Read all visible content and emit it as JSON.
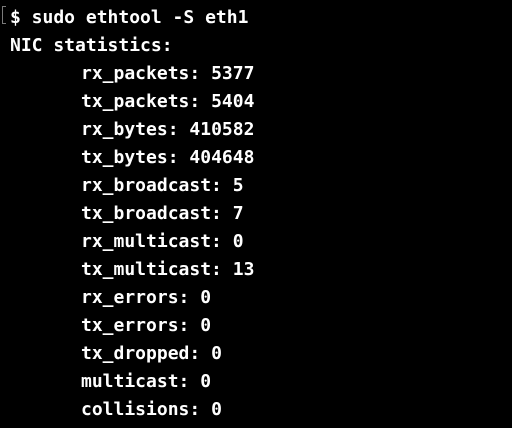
{
  "terminal": {
    "command": "$ sudo ethtool -S eth1",
    "header": "NIC statistics:",
    "stats": [
      {
        "name": "rx_packets",
        "value": "5377"
      },
      {
        "name": "tx_packets",
        "value": "5404"
      },
      {
        "name": "rx_bytes",
        "value": "410582"
      },
      {
        "name": "tx_bytes",
        "value": "404648"
      },
      {
        "name": "rx_broadcast",
        "value": "5"
      },
      {
        "name": "tx_broadcast",
        "value": "7"
      },
      {
        "name": "rx_multicast",
        "value": "0"
      },
      {
        "name": "tx_multicast",
        "value": "13"
      },
      {
        "name": "rx_errors",
        "value": "0"
      },
      {
        "name": "tx_errors",
        "value": "0"
      },
      {
        "name": "tx_dropped",
        "value": "0"
      },
      {
        "name": "multicast",
        "value": "0"
      },
      {
        "name": "collisions",
        "value": "0"
      }
    ]
  }
}
